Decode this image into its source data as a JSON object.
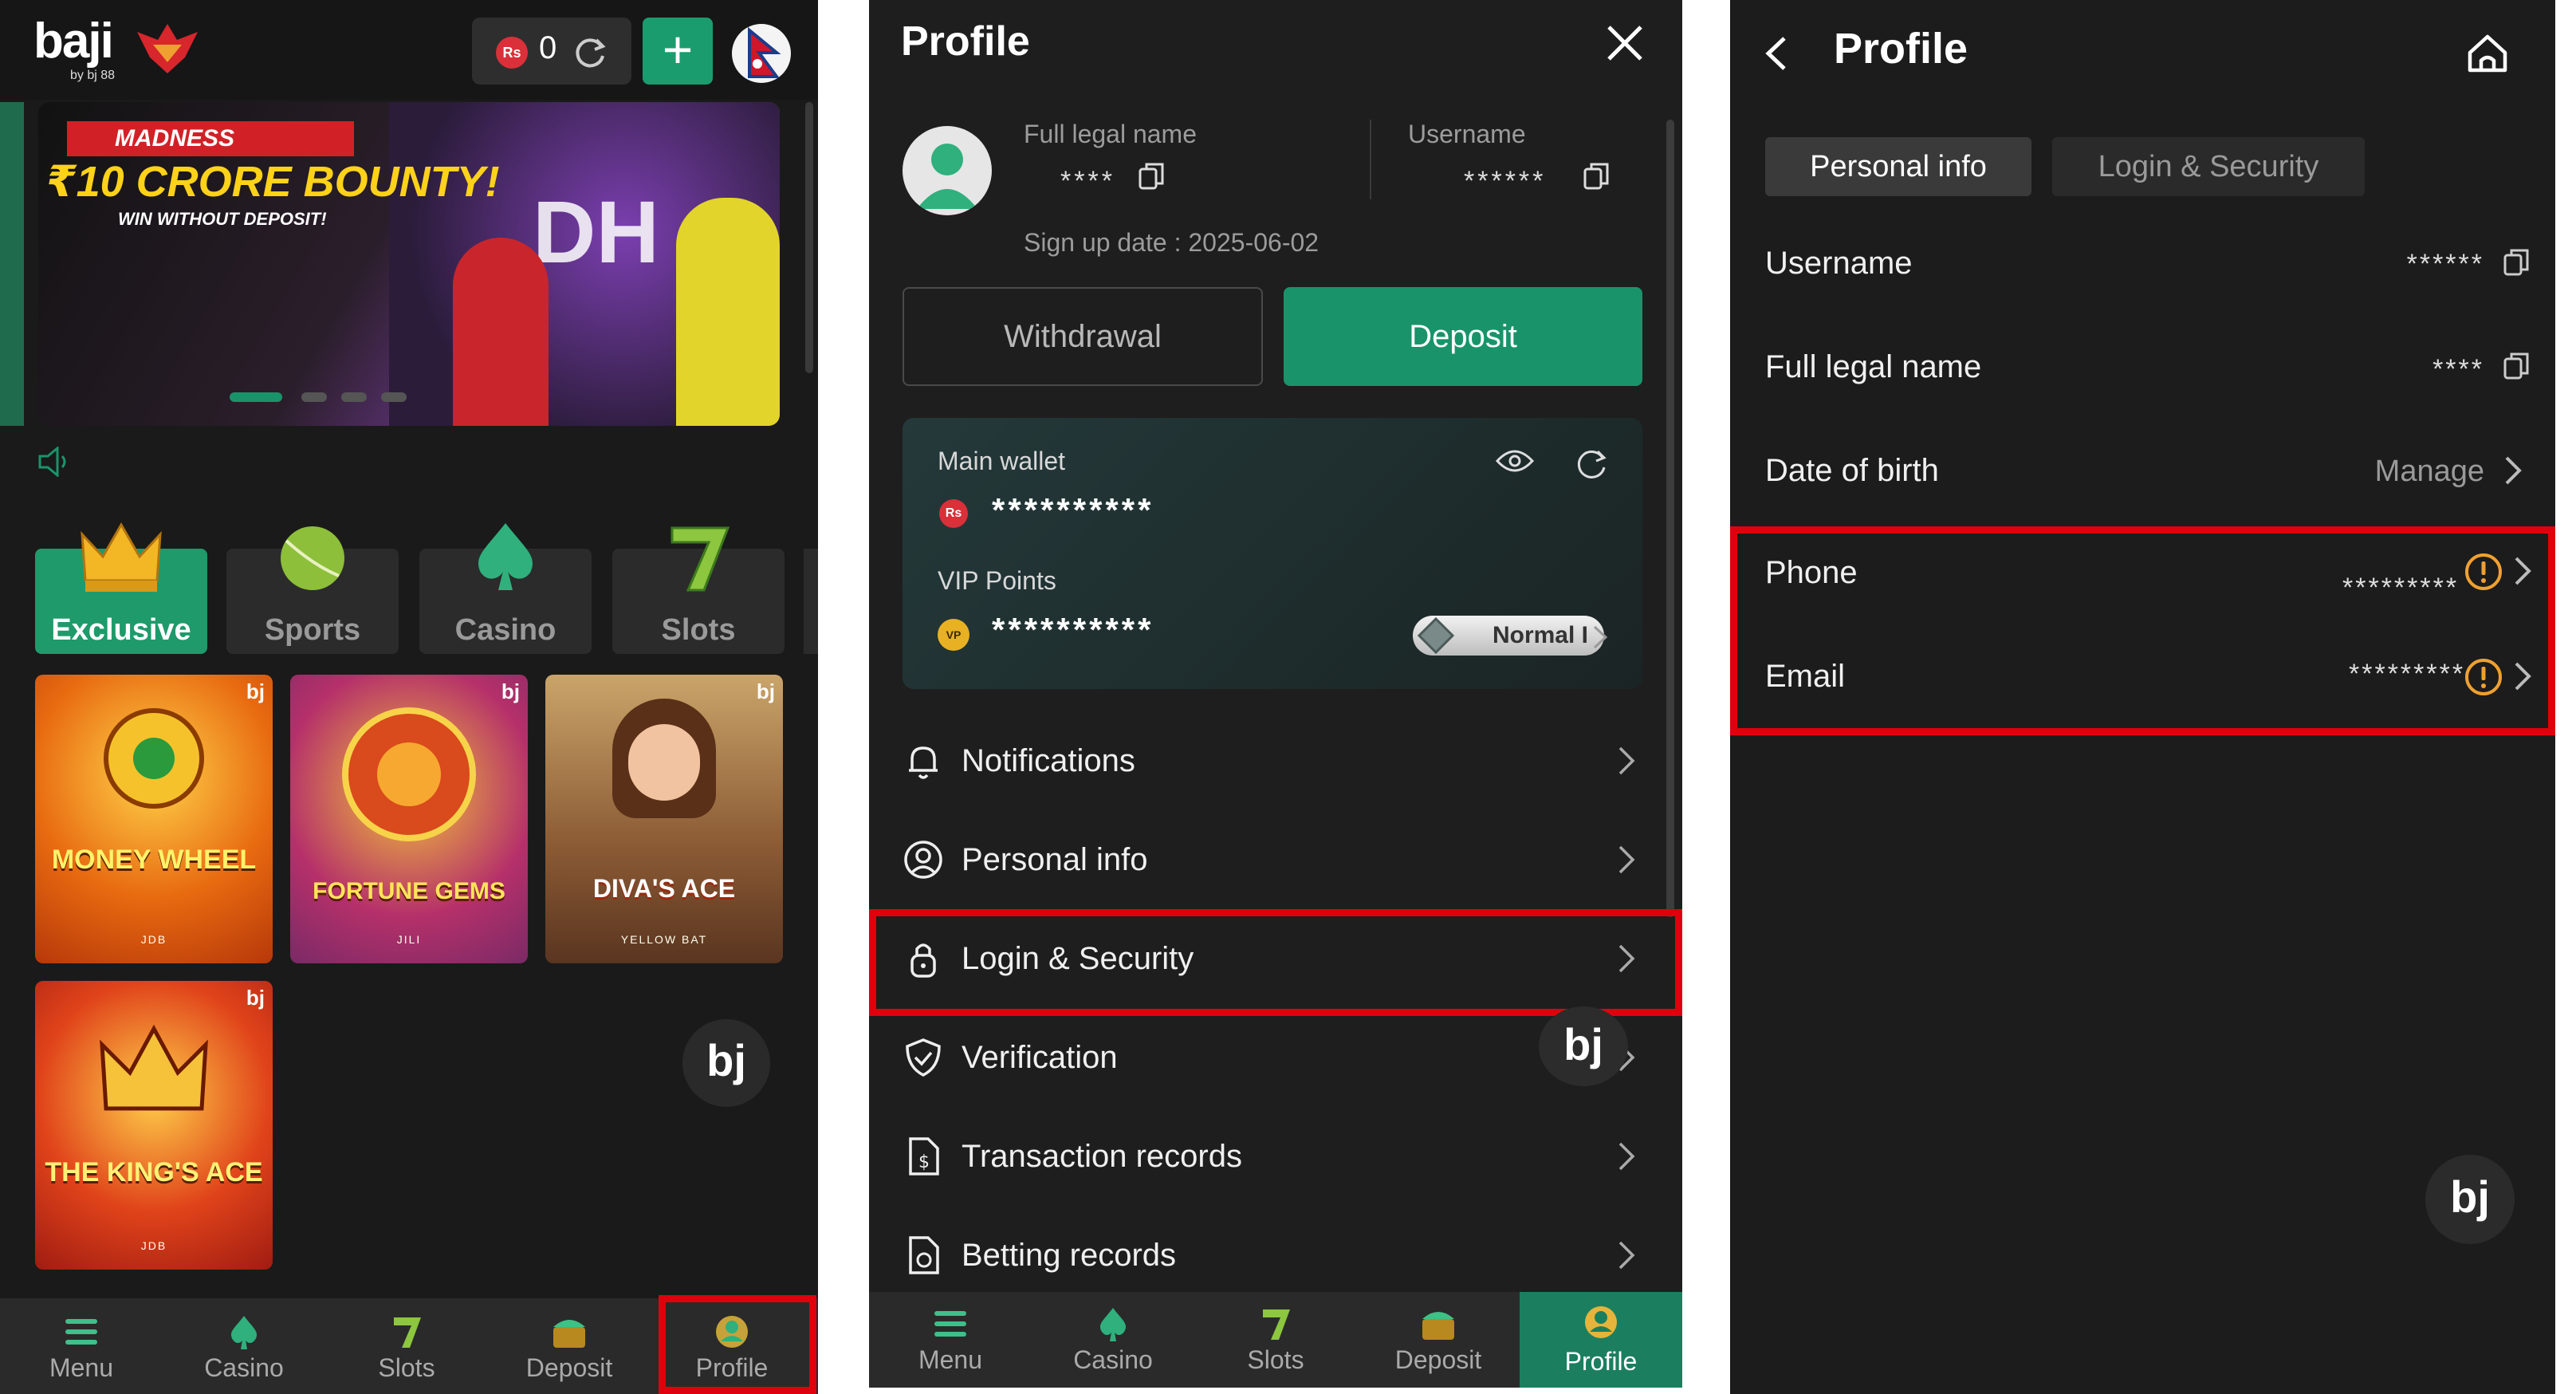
{
  "home": {
    "logo": "baji",
    "logo_sub": "by bj 88",
    "balance": "0",
    "currency_badge": "Rs",
    "banner": {
      "line1": "MADNESS",
      "line2": "₹10 CRORE BOUNTY!",
      "line3": "WIN WITHOUT DEPOSIT!",
      "team_text": "DH"
    },
    "categories": [
      {
        "label": "Exclusive",
        "icon": "crown-icon",
        "active": true
      },
      {
        "label": "Sports",
        "icon": "cricket-ball-icon",
        "active": false
      },
      {
        "label": "Casino",
        "icon": "spade-icon",
        "active": false
      },
      {
        "label": "Slots",
        "icon": "seven-icon",
        "active": false
      }
    ],
    "games": [
      {
        "title": "MONEY WHEEL",
        "provider": "JDB",
        "badge": "bj"
      },
      {
        "title": "FORTUNE GEMS",
        "provider": "JILI",
        "badge": "bj"
      },
      {
        "title": "DIVA'S ACE",
        "provider": "YELLOW BAT",
        "badge": "bj"
      },
      {
        "title": "THE KING'S ACE",
        "provider": "JDB",
        "badge": "bj"
      }
    ],
    "float_badge": "bj",
    "nav": [
      "Menu",
      "Casino",
      "Slots",
      "Deposit",
      "Profile"
    ]
  },
  "profile": {
    "title": "Profile",
    "full_name_label": "Full legal name",
    "full_name_value": "****",
    "username_label": "Username",
    "username_value": "******",
    "signup": "Sign up date : 2025-06-02",
    "withdraw": "Withdrawal",
    "deposit": "Deposit",
    "main_wallet_label": "Main wallet",
    "main_wallet_value": "**********",
    "wallet_currency": "Rs",
    "vip_label": "VIP Points",
    "vip_value": "**********",
    "vip_badge_icon": "VP",
    "vip_level": "Normal I",
    "menu": [
      {
        "label": "Notifications",
        "icon": "bell-icon"
      },
      {
        "label": "Personal info",
        "icon": "user-circle-icon"
      },
      {
        "label": "Login & Security",
        "icon": "lock-icon"
      },
      {
        "label": "Verification",
        "icon": "shield-check-icon"
      },
      {
        "label": "Transaction records",
        "icon": "document-dollar-icon"
      },
      {
        "label": "Betting records",
        "icon": "document-bet-icon"
      }
    ],
    "float_badge": "bj",
    "nav": [
      "Menu",
      "Casino",
      "Slots",
      "Deposit",
      "Profile"
    ]
  },
  "detail": {
    "title": "Profile",
    "tabs": [
      "Personal info",
      "Login & Security"
    ],
    "rows": [
      {
        "label": "Username",
        "value": "******"
      },
      {
        "label": "Full legal name",
        "value": "****"
      },
      {
        "label": "Date of birth",
        "value": "Manage"
      },
      {
        "label": "Phone",
        "value": "*********"
      },
      {
        "label": "Email",
        "value": "*********"
      }
    ],
    "float_badge": "bj"
  },
  "colors": {
    "accent_green": "#19946a",
    "highlight_red": "#e0000d",
    "warning_orange": "#f0a030"
  }
}
